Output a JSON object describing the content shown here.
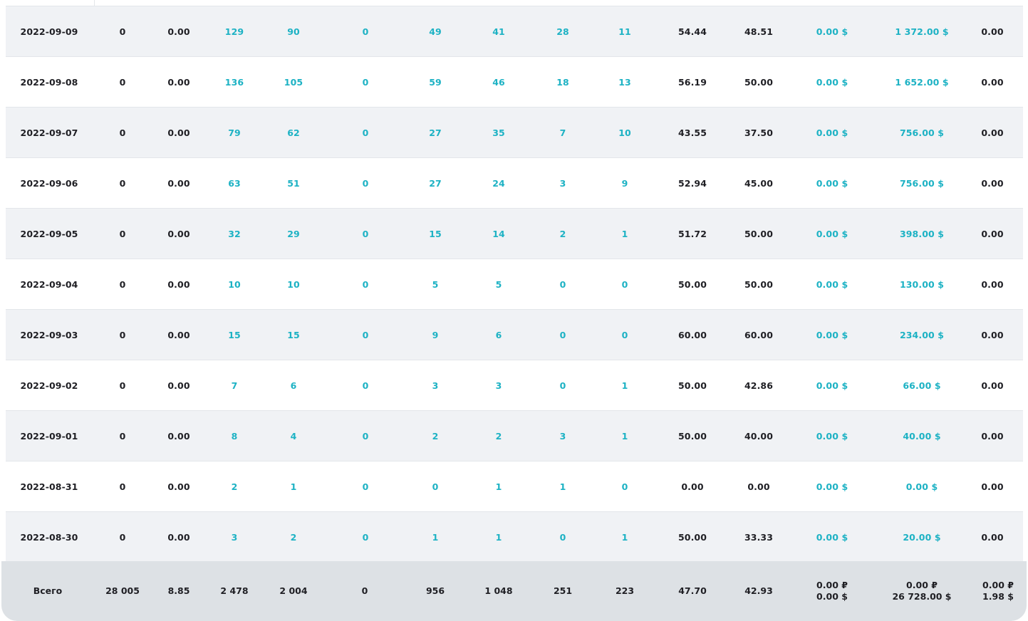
{
  "rows": [
    {
      "date": "2022-09-09",
      "c1": "0",
      "c2": "0.00",
      "c3": "129",
      "c4": "90",
      "c5": "0",
      "c6": "49",
      "c7": "41",
      "c8": "28",
      "c9": "11",
      "c10": "54.44",
      "c11": "48.51",
      "c12": "0.00 $",
      "c13": "1 372.00 $",
      "c14": "0.00"
    },
    {
      "date": "2022-09-08",
      "c1": "0",
      "c2": "0.00",
      "c3": "136",
      "c4": "105",
      "c5": "0",
      "c6": "59",
      "c7": "46",
      "c8": "18",
      "c9": "13",
      "c10": "56.19",
      "c11": "50.00",
      "c12": "0.00 $",
      "c13": "1 652.00 $",
      "c14": "0.00"
    },
    {
      "date": "2022-09-07",
      "c1": "0",
      "c2": "0.00",
      "c3": "79",
      "c4": "62",
      "c5": "0",
      "c6": "27",
      "c7": "35",
      "c8": "7",
      "c9": "10",
      "c10": "43.55",
      "c11": "37.50",
      "c12": "0.00 $",
      "c13": "756.00 $",
      "c14": "0.00"
    },
    {
      "date": "2022-09-06",
      "c1": "0",
      "c2": "0.00",
      "c3": "63",
      "c4": "51",
      "c5": "0",
      "c6": "27",
      "c7": "24",
      "c8": "3",
      "c9": "9",
      "c10": "52.94",
      "c11": "45.00",
      "c12": "0.00 $",
      "c13": "756.00 $",
      "c14": "0.00"
    },
    {
      "date": "2022-09-05",
      "c1": "0",
      "c2": "0.00",
      "c3": "32",
      "c4": "29",
      "c5": "0",
      "c6": "15",
      "c7": "14",
      "c8": "2",
      "c9": "1",
      "c10": "51.72",
      "c11": "50.00",
      "c12": "0.00 $",
      "c13": "398.00 $",
      "c14": "0.00"
    },
    {
      "date": "2022-09-04",
      "c1": "0",
      "c2": "0.00",
      "c3": "10",
      "c4": "10",
      "c5": "0",
      "c6": "5",
      "c7": "5",
      "c8": "0",
      "c9": "0",
      "c10": "50.00",
      "c11": "50.00",
      "c12": "0.00 $",
      "c13": "130.00 $",
      "c14": "0.00"
    },
    {
      "date": "2022-09-03",
      "c1": "0",
      "c2": "0.00",
      "c3": "15",
      "c4": "15",
      "c5": "0",
      "c6": "9",
      "c7": "6",
      "c8": "0",
      "c9": "0",
      "c10": "60.00",
      "c11": "60.00",
      "c12": "0.00 $",
      "c13": "234.00 $",
      "c14": "0.00"
    },
    {
      "date": "2022-09-02",
      "c1": "0",
      "c2": "0.00",
      "c3": "7",
      "c4": "6",
      "c5": "0",
      "c6": "3",
      "c7": "3",
      "c8": "0",
      "c9": "1",
      "c10": "50.00",
      "c11": "42.86",
      "c12": "0.00 $",
      "c13": "66.00 $",
      "c14": "0.00"
    },
    {
      "date": "2022-09-01",
      "c1": "0",
      "c2": "0.00",
      "c3": "8",
      "c4": "4",
      "c5": "0",
      "c6": "2",
      "c7": "2",
      "c8": "3",
      "c9": "1",
      "c10": "50.00",
      "c11": "40.00",
      "c12": "0.00 $",
      "c13": "40.00 $",
      "c14": "0.00"
    },
    {
      "date": "2022-08-31",
      "c1": "0",
      "c2": "0.00",
      "c3": "2",
      "c4": "1",
      "c5": "0",
      "c6": "0",
      "c7": "1",
      "c8": "1",
      "c9": "0",
      "c10": "0.00",
      "c11": "0.00",
      "c12": "0.00 $",
      "c13": "0.00 $",
      "c14": "0.00"
    },
    {
      "date": "2022-08-30",
      "c1": "0",
      "c2": "0.00",
      "c3": "3",
      "c4": "2",
      "c5": "0",
      "c6": "1",
      "c7": "1",
      "c8": "0",
      "c9": "1",
      "c10": "50.00",
      "c11": "33.33",
      "c12": "0.00 $",
      "c13": "20.00 $",
      "c14": "0.00"
    }
  ],
  "total": {
    "label": "Всего",
    "c1": "28 005",
    "c2": "8.85",
    "c3": "2 478",
    "c4": "2 004",
    "c5": "0",
    "c6": "956",
    "c7": "1 048",
    "c8": "251",
    "c9": "223",
    "c10": "47.70",
    "c11": "42.93",
    "c12_rub": "0.00 ₽",
    "c12_usd": "0.00 $",
    "c13_rub": "0.00 ₽",
    "c13_usd": "26 728.00 $",
    "c14_rub": "0.00 ₽",
    "c14_usd": "1.98 $"
  },
  "colors": {
    "accent": "#1db2c4",
    "text": "#1f1f24",
    "row_alt": "#f0f2f5",
    "total_bg": "#dde1e5"
  }
}
